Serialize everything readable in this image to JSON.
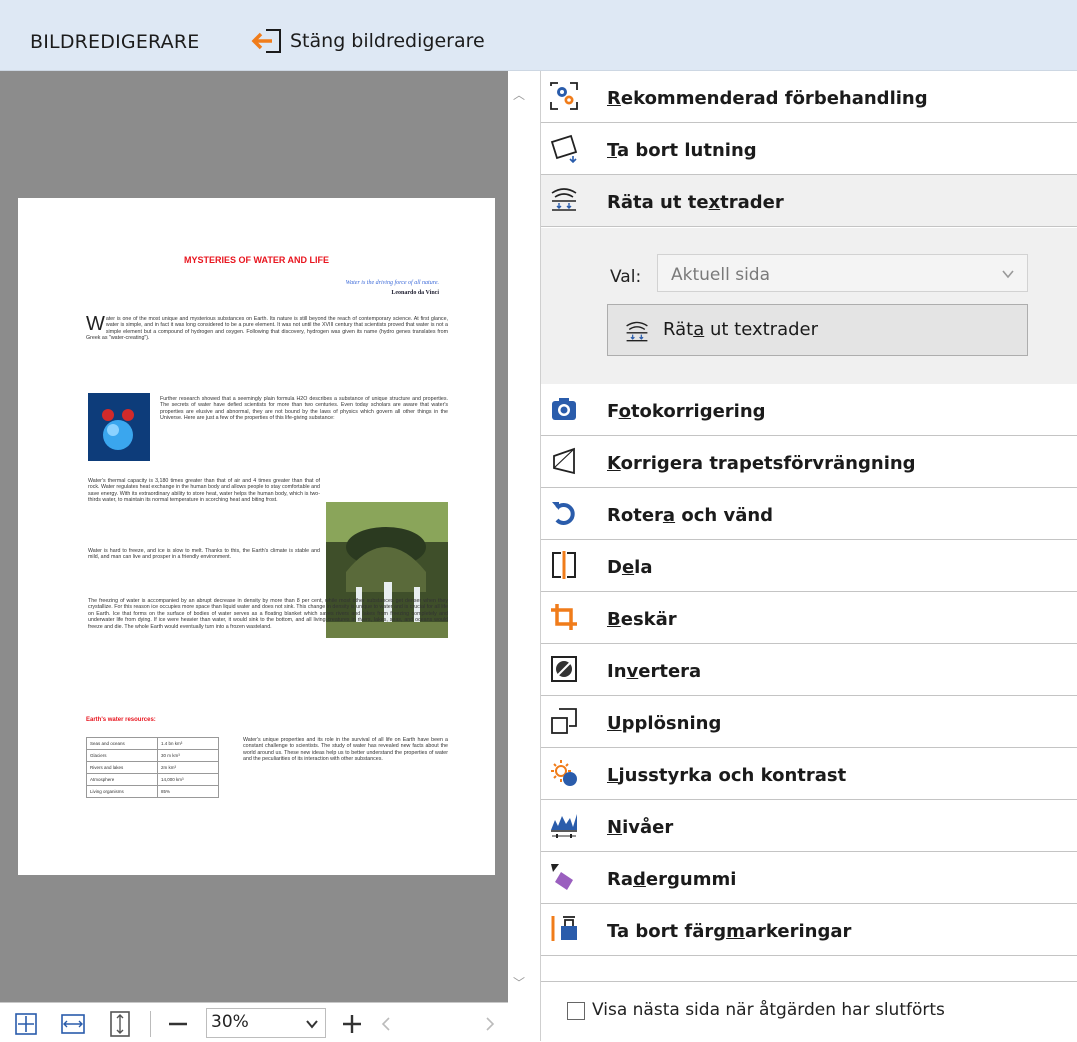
{
  "titlebar": {
    "title": "BILDREDIGERARE",
    "close_label": "Stäng bildredigerare",
    "close_icon": "exit-arrow-icon",
    "accent_color": "#f07c1a"
  },
  "preview": {
    "document": {
      "title": "MYSTERIES OF WATER AND LIFE",
      "quote": "Water is the driving force of all nature.",
      "quote_author": "Leonardo da Vinci",
      "para1_dropcap": "W",
      "para1": "ater is one of the most unique and mysterious substances on Earth. Its nature is still beyond the reach of contemporary science. At first glance, water is simple, and in fact it was long considered to be a pure element. It was not until the XVIII century that scientists proved that water is not a simple element but a compound of hydrogen and oxygen. Following that discovery, hydrogen was given its name (hydro genes translates from Greek as \"water-creating\").",
      "para2": "Further research showed that a seemingly plain formula H2O describes a substance of unique structure and properties. The secrets of water have defied scientists for more than two centuries. Even today scholars are aware that water's properties are elusive and abnormal, they are not bound by the laws of physics which govern all other things in the Universe. Here are just a few of the properties of this life-giving substance:",
      "bullet1": "Water's thermal capacity is 3,180 times greater than that of air and 4 times greater than that of rock. Water regulates heat exchange in the human body and allows people to stay comfortable and save energy. With its extraordinary ability to store heat, water helps the human body, which is two-thirds water, to maintain its normal temperature in scorching heat and biting frost.",
      "bullet2": "Water is hard to freeze, and ice is slow to melt. Thanks to this, the Earth's climate is stable and mild, and man can live and prosper in a friendly environment.",
      "bullet3": "The freezing of water is accompanied by an abrupt decrease in density by more than 8 per cent, while most other substances get denser when they crystallize. For this reason ice occupies more space than liquid water and does not sink. This change in density is unique to water and is crucial for all life on Earth. Ice that forms on the surface of bodies of water serves as a floating blanket which saves rivers and lakes from freezing completely and underwater life from dying. If ice were heavier than water, it would sink to the bottom, and all living creatures in rivers, lakes, seas, and oceans would freeze and die. The whole Earth would eventually turn into a frozen wasteland.",
      "heading2": "Earth's water resources:",
      "table": [
        [
          "Seas and oceans",
          "1.4 bn km³"
        ],
        [
          "Glaciers",
          "30 m km³"
        ],
        [
          "Rivers and lakes",
          "2m km³"
        ],
        [
          "Atmosphere",
          "14,000 km³"
        ],
        [
          "Living organisms",
          "85%"
        ]
      ],
      "para3": "Water's unique properties and its role in the survival of all life on Earth have been a constant challenge to scientists. The study of water has revealed new facts about the world around us. These new ideas help us to better understand the properties of water and the peculiarities of its interaction with other substances."
    }
  },
  "bottombar": {
    "zoom_value": "30%",
    "fit_page_icon": "fit-page-icon",
    "fit_width_icon": "fit-width-icon",
    "fit_height_icon": "fit-height-icon",
    "zoom_out_icon": "minus-icon",
    "zoom_in_icon": "plus-icon"
  },
  "tools": [
    {
      "pre": "",
      "mn": "R",
      "post": "ekommenderad förbehandling",
      "icon": "gear-preprocess-icon"
    },
    {
      "pre": "",
      "mn": "T",
      "post": "a bort lutning",
      "icon": "deskew-icon"
    },
    {
      "pre": "Räta ut te",
      "mn": "x",
      "post": "trader",
      "icon": "straighten-lines-icon"
    },
    {
      "pre": "F",
      "mn": "o",
      "post": "tokorrigering",
      "icon": "camera-icon"
    },
    {
      "pre": "",
      "mn": "K",
      "post": "orrigera trapetsförvrängning",
      "icon": "trapezoid-icon"
    },
    {
      "pre": "Roter",
      "mn": "a",
      "post": " och vänd",
      "icon": "rotate-icon"
    },
    {
      "pre": "D",
      "mn": "e",
      "post": "la",
      "icon": "split-icon"
    },
    {
      "pre": "",
      "mn": "B",
      "post": "eskär",
      "icon": "crop-icon"
    },
    {
      "pre": "In",
      "mn": "v",
      "post": "ertera",
      "icon": "invert-icon"
    },
    {
      "pre": "",
      "mn": "U",
      "post": "pplösning",
      "icon": "resolution-icon"
    },
    {
      "pre": "",
      "mn": "L",
      "post": "jusstyrka och kontrast",
      "icon": "brightness-icon"
    },
    {
      "pre": "",
      "mn": "N",
      "post": "ivåer",
      "icon": "levels-icon"
    },
    {
      "pre": "Ra",
      "mn": "d",
      "post": "ergummi",
      "icon": "eraser-icon"
    },
    {
      "pre": "Ta bort färg",
      "mn": "m",
      "post": "arkeringar",
      "icon": "remove-color-marks-icon"
    }
  ],
  "straighten_panel": {
    "select_label": "Val:",
    "select_value": "Aktuell sida",
    "button_pre": "Rät",
    "button_mn": "a",
    "button_post": " ut textrader"
  },
  "footer": {
    "checkbox_label": "Visa nästa sida när åtgärden har slutförts"
  }
}
